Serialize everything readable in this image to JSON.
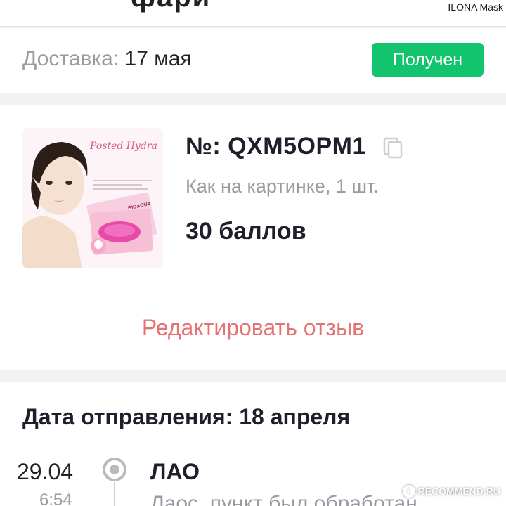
{
  "topbar": {
    "title_partial": "фари",
    "brand_label": "ILONA Mask"
  },
  "delivery": {
    "label": "Доставка:",
    "date": "17 мая",
    "status": "Получен",
    "status_color": "#12c46d"
  },
  "product": {
    "order_number": "№: QXM5OPM1",
    "variant": "Как на картинке, 1 шт.",
    "price": "30 баллов",
    "image_caption": "Posted Hydra",
    "image_brand": "BIOAQUA",
    "edit_review_label": "Редактировать отзыв",
    "edit_review_color": "#e57373"
  },
  "shipping": {
    "dispatch_label": "Дата отправления: 18 апреля",
    "timeline": [
      {
        "date": "29.04",
        "time": "6:54",
        "event": "ЛАО",
        "description": "Лаос, пункт был обработан"
      }
    ]
  },
  "watermark": {
    "text": "RECOMMEND.RU",
    "mark": "i"
  }
}
